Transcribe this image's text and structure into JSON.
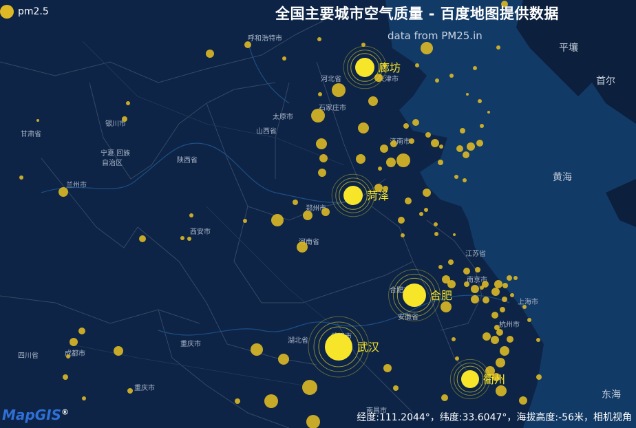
{
  "title": "全国主要城市空气质量 - 百度地图提供数据",
  "subtitle": "data from PM25.in",
  "legend": {
    "label": "pm2.5",
    "color": "#ddb926"
  },
  "colors": {
    "ocean": "#123a66",
    "land": "#0a1b35",
    "point": "#ddb926",
    "highlight": "#f7e52a",
    "label": "#f7e52a"
  },
  "status": {
    "coords": "经度:111.2044°，纬度:33.6047°，海拔高度:-56米，相机视角"
  },
  "logo": {
    "text": "MapGIS",
    "mark": "®"
  },
  "base_labels": [
    "平壤",
    "首尔",
    "黄海",
    "东海",
    "呼和浩特市",
    "天津市",
    "河北省",
    "石家庄市",
    "太原市",
    "山西省",
    "济南市",
    "银川市",
    "宁夏 回族",
    "自治区",
    "兰州市",
    "甘肃省",
    "陕西省",
    "西安市",
    "郑州市",
    "河南省",
    "江苏省",
    "南京市",
    "合肥市",
    "安徽省",
    "上海市",
    "杭州市",
    "湖北省",
    "武汉市",
    "重庆市",
    "四川省",
    "成都市",
    "南昌市",
    "重庆市"
  ],
  "top_cities": [
    {
      "name": "廊坊"
    },
    {
      "name": "菏泽"
    },
    {
      "name": "合肥"
    },
    {
      "name": "武汉"
    },
    {
      "name": "衢州"
    }
  ]
}
